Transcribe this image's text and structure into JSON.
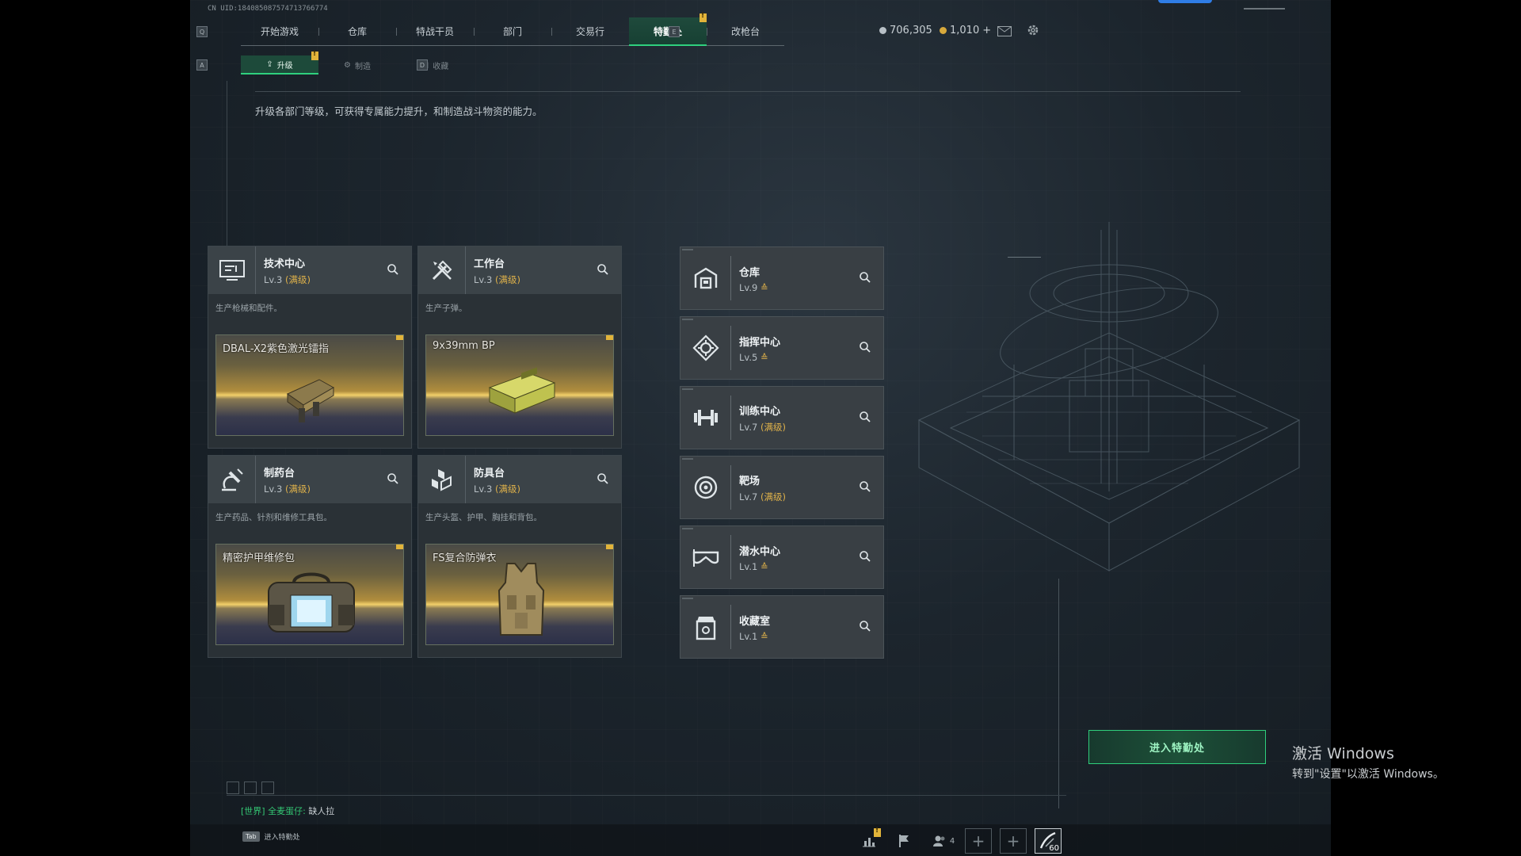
{
  "header": {
    "uid": "CN UID:184085087574713766774",
    "nav_key_left": "Q",
    "nav_key_right": "E",
    "tabs": [
      {
        "label": "开始游戏",
        "active": false
      },
      {
        "label": "仓库",
        "active": false
      },
      {
        "label": "特战干员",
        "active": false
      },
      {
        "label": "部门",
        "active": false
      },
      {
        "label": "交易行",
        "active": false
      },
      {
        "label": "特勤处",
        "active": true
      },
      {
        "label": "改枪台",
        "active": false
      }
    ],
    "currency_silver": "706,305",
    "currency_gold": "1,010",
    "currency_plus": "+",
    "colors": {
      "accent_green": "#2fd07e",
      "notice_yellow": "#e2b43a",
      "max_level": "#e0b24a",
      "brand_blue": "#2f7de6"
    }
  },
  "subnav": {
    "key_left": "A",
    "key_right": "D",
    "tabs": [
      {
        "label": "升级",
        "icon": "upgrade-icon",
        "active": true
      },
      {
        "label": "制造",
        "icon": "craft-icon",
        "active": false
      },
      {
        "label": "收藏",
        "icon": "collection-icon",
        "active": false
      }
    ]
  },
  "description": "升级各部门等级，可获得专属能力提升，和制造战斗物资的能力。",
  "stations": [
    {
      "name": "技术中心",
      "level": "Lv.3",
      "max": "(满级)",
      "desc": "生产枪械和配件。",
      "item": "DBAL-X2紫色激光镭指",
      "icon": "tech-center-icon"
    },
    {
      "name": "工作台",
      "level": "Lv.3",
      "max": "(满级)",
      "desc": "生产子弹。",
      "item": "9x39mm BP",
      "icon": "workbench-icon"
    },
    {
      "name": "制药台",
      "level": "Lv.3",
      "max": "(满级)",
      "desc": "生产药品、针剂和维修工具包。",
      "item": "精密护甲维修包",
      "icon": "pharmacy-icon"
    },
    {
      "name": "防具台",
      "level": "Lv.3",
      "max": "(满级)",
      "desc": "生产头盔、护甲、胸挂和背包。",
      "item": "FS复合防弹衣",
      "icon": "armor-bench-icon"
    }
  ],
  "facilities": [
    {
      "name": "仓库",
      "level": "Lv.9",
      "max": "",
      "upgradable": true,
      "icon": "warehouse-icon"
    },
    {
      "name": "指挥中心",
      "level": "Lv.5",
      "max": "",
      "upgradable": true,
      "icon": "command-center-icon"
    },
    {
      "name": "训练中心",
      "level": "Lv.7",
      "max": "(满级)",
      "upgradable": false,
      "icon": "training-center-icon"
    },
    {
      "name": "靶场",
      "level": "Lv.7",
      "max": "(满级)",
      "upgradable": false,
      "icon": "shooting-range-icon"
    },
    {
      "name": "潜水中心",
      "level": "Lv.1",
      "max": "",
      "upgradable": true,
      "icon": "diving-center-icon"
    },
    {
      "name": "收藏室",
      "level": "Lv.1",
      "max": "",
      "upgradable": true,
      "icon": "collection-room-icon"
    }
  ],
  "enter_button": "进入特勤处",
  "chat": {
    "channel": "[世界]",
    "user": "全麦蛋仔:",
    "message": "缺人拉"
  },
  "bottom": {
    "tab_key": "Tab",
    "tab_hint": "进入特勤处",
    "team_count": "4",
    "timer": "60"
  },
  "windows": {
    "line1": "激活 Windows",
    "line2": "转到\"设置\"以激活 Windows。"
  }
}
